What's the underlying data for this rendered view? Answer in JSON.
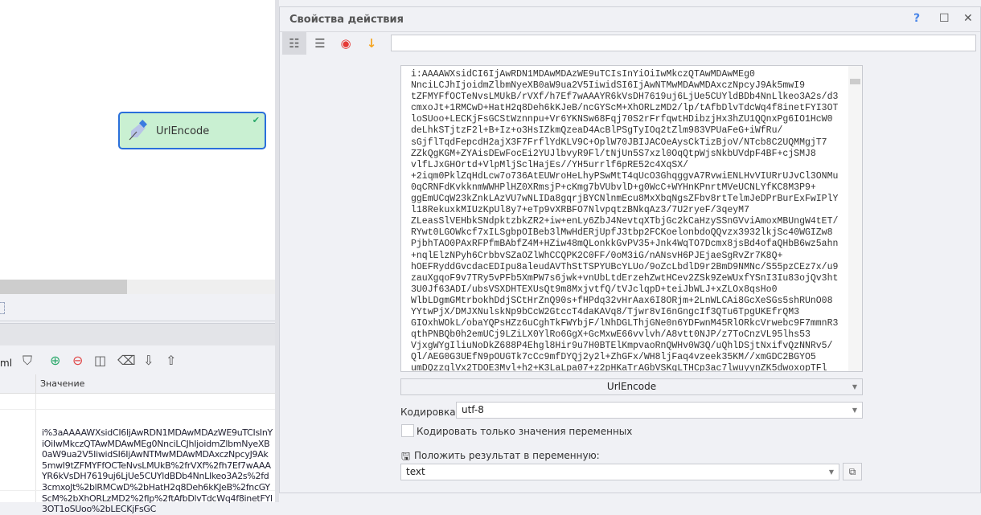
{
  "node": {
    "label": "UrlEncode"
  },
  "variables_panel": {
    "toolbar_partial_label": "ml",
    "column_header": "Значение",
    "row_value": "i%3aAAAAWXsidCI6IjAwRDN1MDAwMDAzWE9uTCIsInYiOiIwMkczQTAwMDAwMEg0NnciLCJhIjoidmZlbmNyeXB0aW9ua2V5IiwidSI6IjAwNTMwMDAwMDAxczNpcyJ9Ak5mwI9tZFMYFfOCTeNvsLMUkB%2frVXf%2fh7Ef7wAAAYR6kVsDH7619uj6LjUe5CUYldBDb4NnLlkeo3A2s%2fd3cmxoJt%2blRMCwD%2bHatH2q8Deh6kKJeB%2fncGYScM%2bXhORLzMD2%2flp%2ftAfbDlvTdcWq4f8inetFYI3OT1oSUoo%2bLECKjFsGC"
  },
  "dialog": {
    "title": "Свойства действия",
    "help": "?",
    "input_lines": [
      "i:AAAAWXsidCI6IjAwRDN1MDAwMDAzWE9uTCIsInYiOiIwMkczQTAwMDAwMEg0",
      "NnciLCJhIjoidmZlbmNyeXB0aW9ua2V5IiwidSI6IjAwNTMwMDAwMDAxczNpcyJ9Ak5mwI9",
      "tZFMYFfOCTeNvsLMUkB/rVXf/h7Ef7wAAAYR6kVsDH7619uj6LjUe5CUYldBDb4NnLlkeo3A2s/d3",
      "cmxoJt+1RMCwD+HatH2q8Deh6kKJeB/ncGYScM+XhORLzMD2/lp/tAfbDlvTdcWq4f8inetFYI3OT",
      "loSUoo+LECKjFsGCStWznnpu+Vr6YKNSw68Fqj70S2rFrfqwtHDibzjHx3hZU1QQnxPg6IO1HcW0",
      "deLhkSTjtzF2l+B+Iz+o3HsIZkmQzeaD4AcBlPSgTyIOq2tZlm983VPUaFeG+iWfRu/",
      "sGjflTqdFepcdH2ajX3F7FrflYdKLV9C+OplW70JBIJACOeAysCkTizBjoV/NTcb8C2UQMMgjT7",
      "ZZkQgKGM+ZYAisDEwFocEi2YUJlbvyR9Fl/tNjUn5S7xzl0OqQtpWjsNkbUVdpF4BF+cjSMJ8",
      "vlfLJxGHOrtd+VlpMljSclHajEs//YH5urrlf6pRE52c4XqSX/",
      "+2iqm0PklZqHdLcw7o736AtEUWroHeLhyPSwMtT4qUcO3GhqggvA7RvwiENLHvVIURrUJvCl3ONMu",
      "0qCRNFdKvkknmWWHPlHZ0XRmsjP+cKmg7bVUbvlD+g0WcC+WYHnKPnrtMVeUCNLYfKC8M3P9+",
      "ggEmUCqW23kZnkLAzVU7wNLIDa8gqrjBYCNlnmEcu8MxXbqNgsZFbv8rtTelmJeDPrBurExFwIPlY",
      "l18RekuxkMIUzKpUl8y7+eTp9vXRBFO7NlvpqtzBNkqAz3/7U2ryeF/3qeyM7",
      "ZLeasSlVEHbkSNdpktzbkZR2+iw+enLy6ZbJ4NevtqXTbjGc2kCaHzySSnGVviAmoxMBUngW4tET/",
      "RYwt0LGOWkcf7xILSgbpOIBeb3lMwHdERjUpfJ3tbp2FCKoelonbdoQQvzx3932lkjSc40WGIZw8",
      "PjbhTAO0PAxRFPfmBAbfZ4M+HZiw48mQLonkkGvPV35+Jnk4WqTO7Dcmx8jsBd4ofaQHbB6wz5ahn",
      "+nqlElzNPyh6CrbbvSZaOZlWhCCQPK2C0FF/0oM3iG/nANsvH6PJEjaeSgRvZr7K8Q+",
      "hOEFRyddGvcdacEDIpu8aleudAVThStTSPYUBcYLUo/9oZcLbdlD9r2BmD9NMNc/S55pzCEz7x/u9",
      "zauXgqoF9v7TRy5vPFb5XmPW7s6jwk+vnUbLtdErzehZwtHCev2ZSk9ZeWUxfYSnI3Iu83ojQv3ht",
      "3U0Jf63ADI/ubsVSXDHTEXUsQt9m8MxjvtfQ/tVJclqpD+teiJbWLJ+xZLOx8qsHo0",
      "WlbLDgmGMtrbokhDdjSCtHrZnQ90s+fHPdq32vHrAax6I8ORjm+2LnWLCAi8GcXeSGs5shRUnO08",
      "YYtwPjX/DMJXNulskNp9bCcW2GtccT4daKAVq8/Tjwr8vI6nGngcIf3QTu6TpgUKEfrQM3",
      "GIOxhWOkL/obaYQPsHZz6uCghTkFWYbjF/lNhDGLThjGNe0n6YDFwnM45RlORkcVrwebc9F7mmnR3",
      "qthPNBQb0h2emUCj9LZiLX0YlRo6GgX+GcMxwE66vvlvh/A8vtt0NJP/z7ToCnzVL95lhs53",
      "VjxgWYgIliuNoDkZ688P4Ehgl8Hir9u7H0BTElKmpvaoRnQWHv0W3Q/uQhlDSjtNxifvQzNNRv5/",
      "Ql/AEG0G3UEfN9pOUGTk7cCc9mfDYQj2y2l+ZhGFx/WH8ljFaq4vzeek35KM//xmGDC2BGYO5",
      "umDQzzglVx2TDOE3Mvl+h2+K3LaLpa07+z2pHKaTrAGbVSKgLTHCp3ac7lwuyynZK5dwoxopTFl"
    ],
    "action_select": "UrlEncode",
    "encoding_label": "Кодировка:",
    "encoding_value": "utf-8",
    "only_vars_label": "Кодировать только значения переменных",
    "only_vars_checked": false,
    "result_label": "Положить результат в переменную:",
    "result_var": "text"
  }
}
